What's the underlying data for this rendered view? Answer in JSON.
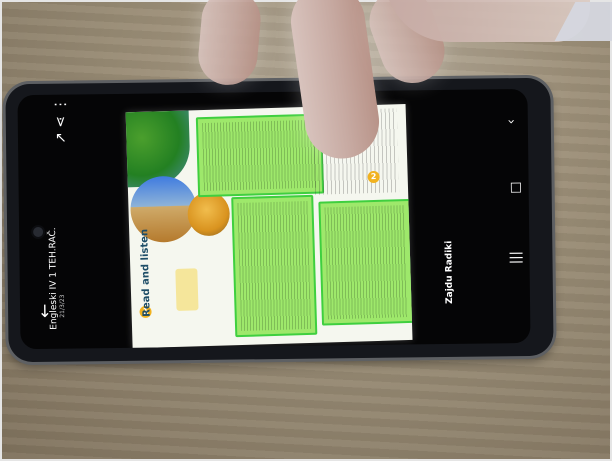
{
  "document": {
    "title": "Engleski IV 1 TEH.RAČ.",
    "date": "21/3/23"
  },
  "lesson": {
    "heading": "Read and listen",
    "number_1": "1",
    "number_2": "2"
  },
  "right_panel": {
    "share": "Zajdu Radiki"
  },
  "icons": {
    "back": "arrow-left-icon",
    "share": "share-icon",
    "forward": "arrow-forward-icon",
    "menu": "more-vertical-icon",
    "recent": "recent-apps-icon",
    "home": "home-button-icon",
    "nav_back": "navigation-back-icon"
  },
  "colors": {
    "phone": "#15171c",
    "highlight": "#9ee86b",
    "accent": "#f1b21f"
  }
}
